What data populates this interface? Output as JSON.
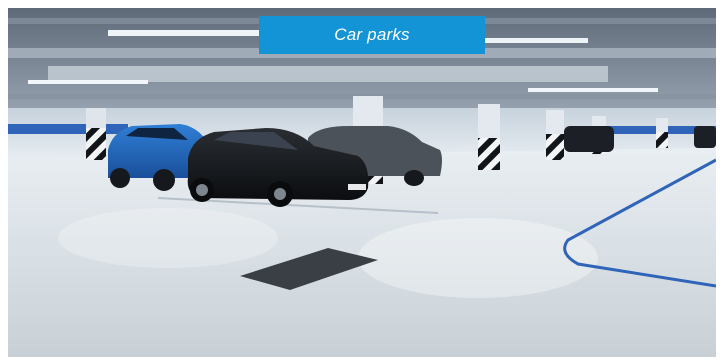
{
  "caption": {
    "label": "Car parks",
    "background_color": "#1394d6",
    "text_color": "#ffffff"
  },
  "photo": {
    "subject": "underground-car-park",
    "accent_color": "#2f64b8"
  }
}
